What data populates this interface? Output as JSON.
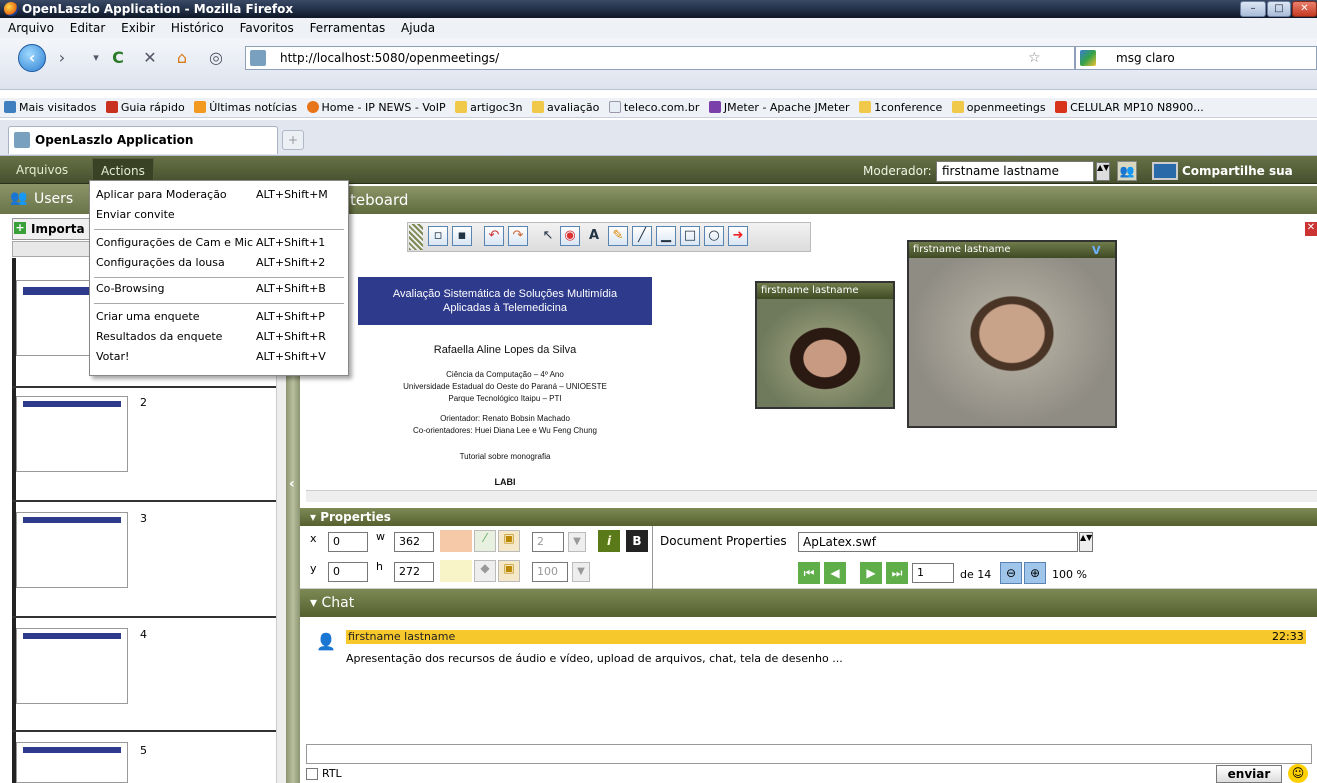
{
  "window": {
    "title": "OpenLaszlo Application - Mozilla Firefox"
  },
  "menubar": {
    "items": [
      "Arquivo",
      "Editar",
      "Exibir",
      "Histórico",
      "Favoritos",
      "Ferramentas",
      "Ajuda"
    ]
  },
  "navbar": {
    "url": "http://localhost:5080/openmeetings/",
    "search": "msg claro"
  },
  "bookmarks": [
    {
      "label": "Mais visitados",
      "color": "#3f7fc0"
    },
    {
      "label": "Guia rápido",
      "color": "#c9301d"
    },
    {
      "label": "Últimas notícias",
      "color": "#f29a1f"
    },
    {
      "label": "Home - IP NEWS - VoIP",
      "color": "#e8741a"
    },
    {
      "label": "artigoc3n",
      "color": "#f0c84a"
    },
    {
      "label": "avaliação",
      "color": "#f0c84a"
    },
    {
      "label": "teleco.com.br",
      "color": "#e8eef6"
    },
    {
      "label": "JMeter - Apache JMeter",
      "color": "#7a3fa8"
    },
    {
      "label": "1conference",
      "color": "#f0c84a"
    },
    {
      "label": "openmeetings",
      "color": "#f0c84a"
    },
    {
      "label": "CELULAR MP10 N8900...",
      "color": "#d8341c"
    }
  ],
  "tab": {
    "label": "OpenLaszlo Application",
    "newtab": "+"
  },
  "app": {
    "menu_arquivos": "Arquivos",
    "menu_actions": "Actions",
    "moderator_label": "Moderador:",
    "moderator_value": "firstname lastname",
    "share_label": "Compartilhe sua tela",
    "users_label": "Users",
    "import_label": "Importa",
    "whiteboard_label": "teboard"
  },
  "dropdown": {
    "items": [
      {
        "label": "Aplicar para Moderação",
        "shortcut": "ALT+Shift+M"
      },
      {
        "label": "Enviar convite",
        "shortcut": ""
      },
      {
        "label": "Configurações de Cam e Mic",
        "shortcut": "ALT+Shift+1"
      },
      {
        "label": "Configurações da lousa",
        "shortcut": "ALT+Shift+2"
      },
      {
        "label": "Co-Browsing",
        "shortcut": "ALT+Shift+B"
      },
      {
        "label": "Criar uma enquete",
        "shortcut": "ALT+Shift+P"
      },
      {
        "label": "Resultados da enquete",
        "shortcut": "ALT+Shift+R"
      },
      {
        "label": "Votar!",
        "shortcut": "ALT+Shift+V"
      }
    ]
  },
  "thumbs": [
    {
      "num": "2"
    },
    {
      "num": "3"
    },
    {
      "num": "4"
    },
    {
      "num": "5"
    }
  ],
  "slide": {
    "title_line1": "Avaliação Sistemática de Soluções Multimídia",
    "title_line2": "Aplicadas à Telemedicina",
    "author": "Rafaella Aline Lopes da Silva",
    "line1": "Ciência da Computação – 4º Ano",
    "line2": "Universidade Estadual do Oeste do Paraná – UNIOESTE",
    "line3": "Parque Tecnológico Itaipu – PTI",
    "line4": "Orientador: Renato Bobsin Machado",
    "line5": "Co-orientadores: Huei Diana Lee e Wu Feng Chung",
    "line6": "Tutorial sobre monografia",
    "logo": "LABI"
  },
  "videos": {
    "v1": "firstname lastname",
    "v2": "firstname lastname"
  },
  "properties": {
    "header": "Properties",
    "x_label": "x",
    "x": "0",
    "w_label": "w",
    "w": "362",
    "y_label": "y",
    "y": "0",
    "h_label": "h",
    "h": "272",
    "stroke": "2",
    "opacity": "100",
    "doc_label": "Document Properties",
    "doc_value": "ApLatex.swf",
    "page": "1",
    "of": "de 14",
    "zoom": "100 %"
  },
  "chat": {
    "header": "Chat",
    "user": "firstname lastname",
    "time": "22:33",
    "message": "Apresentação dos recursos de áudio e vídeo, upload de arquivos, chat, tela de desenho ...",
    "rtl": "RTL",
    "send": "enviar"
  }
}
